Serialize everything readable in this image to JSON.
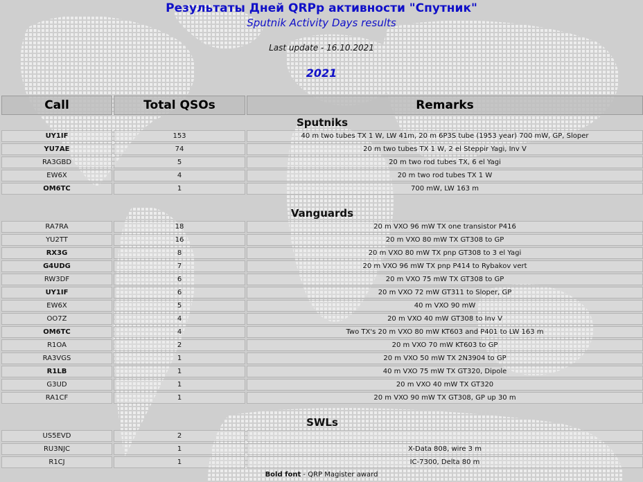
{
  "header": {
    "title_ru": "Результаты Дней QRPp активности \"Спутник\"",
    "title_en": "Sputnik Activity Days results",
    "last_update": "Last update - 16.10.2021",
    "year": "2021"
  },
  "table": {
    "col_call": "Call",
    "col_total": "Total QSOs",
    "col_remarks": "Remarks",
    "sections": [
      {
        "title": "Sputniks",
        "rows": [
          {
            "call": "UY1IF",
            "bold": true,
            "qsos": "153",
            "remarks": "40 m two tubes TX 1 W, LW 41m, 20 m 6P3S tube (1953 year) 700 mW, GP, Sloper"
          },
          {
            "call": "YU7AE",
            "bold": true,
            "qsos": "74",
            "remarks": "20 m two tubes TX 1 W, 2 el Steppir Yagi, Inv V"
          },
          {
            "call": "RA3GBD",
            "bold": false,
            "qsos": "5",
            "remarks": "20 m two rod tubes TX, 6 el Yagi"
          },
          {
            "call": "EW6X",
            "bold": false,
            "qsos": "4",
            "remarks": "20 m two rod tubes TX 1 W"
          },
          {
            "call": "OM6TC",
            "bold": true,
            "qsos": "1",
            "remarks": "700 mW, LW 163 m"
          }
        ]
      },
      {
        "title": "Vanguards",
        "rows": [
          {
            "call": "RA7RA",
            "bold": false,
            "qsos": "18",
            "remarks": "20 m VXO 96 mW TX one transistor P416"
          },
          {
            "call": "YU2TT",
            "bold": false,
            "qsos": "16",
            "remarks": "20 m VXO 80 mW TX GT308 to GP"
          },
          {
            "call": "RX3G",
            "bold": true,
            "qsos": "8",
            "remarks": "20 m VXO 80 mW TX pnp GT308 to 3 el Yagi"
          },
          {
            "call": "G4UDG",
            "bold": true,
            "qsos": "7",
            "remarks": "20 m VXO 96 mW TX pnp P414 to Rybakov vert"
          },
          {
            "call": "RW3DF",
            "bold": false,
            "qsos": "6",
            "remarks": "20 m VXO 75 mW TX GT308 to GP"
          },
          {
            "call": "UY1IF",
            "bold": true,
            "qsos": "6",
            "remarks": "20 m VXO 72 mW GT311 to Sloper, GP"
          },
          {
            "call": "EW6X",
            "bold": false,
            "qsos": "5",
            "remarks": "40 m VXO 90 mW"
          },
          {
            "call": "OO7Z",
            "bold": false,
            "qsos": "4",
            "remarks": "20 m VXO 40 mW GT308 to Inv V"
          },
          {
            "call": "OM6TC",
            "bold": true,
            "qsos": "4",
            "remarks": "Two TX's 20 m VXO 80 mW KT603 and P401 to LW 163 m"
          },
          {
            "call": "R1OA",
            "bold": false,
            "qsos": "2",
            "remarks": "20 m VXO 70 mW KT603 to GP"
          },
          {
            "call": "RA3VGS",
            "bold": false,
            "qsos": "1",
            "remarks": "20 m VXO 50 mW TX 2N3904 to GP"
          },
          {
            "call": "R1LB",
            "bold": true,
            "qsos": "1",
            "remarks": "40 m VXO 75 mW TX GT320, Dipole"
          },
          {
            "call": "G3UD",
            "bold": false,
            "qsos": "1",
            "remarks": "20 m VXO 40 mW TX GT320"
          },
          {
            "call": "RA1CF",
            "bold": false,
            "qsos": "1",
            "remarks": "20 m VXO 90 mW TX GT308, GP up 30 m"
          }
        ]
      },
      {
        "title": "SWLs",
        "rows": [
          {
            "call": "US5EVD",
            "bold": false,
            "qsos": "2",
            "remarks": ""
          },
          {
            "call": "RU3NJC",
            "bold": false,
            "qsos": "1",
            "remarks": "X-Data 808, wire 3 m"
          },
          {
            "call": "R1CJ",
            "bold": false,
            "qsos": "1",
            "remarks": "IC-7300, Delta 80 m"
          }
        ]
      }
    ]
  },
  "footer": {
    "bold_label": "Bold font",
    "text": " - QRP Magister award"
  }
}
